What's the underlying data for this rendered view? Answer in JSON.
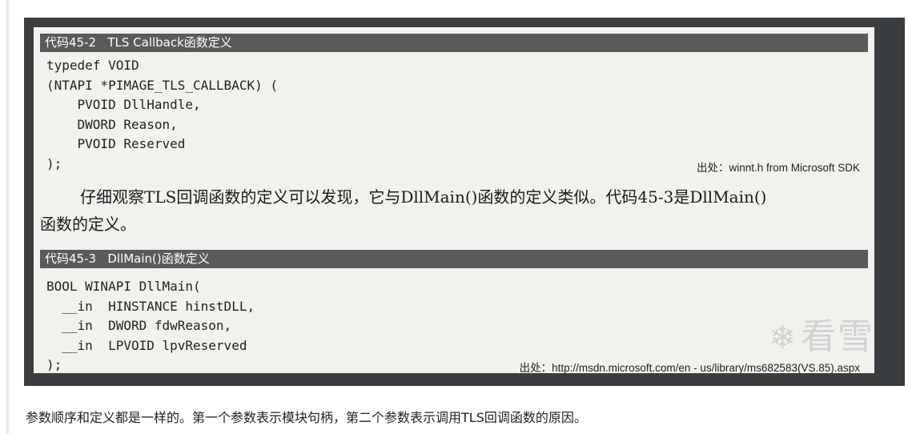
{
  "scan": {
    "listing1": {
      "caption": "代码45-2   TLS Callback函数定义",
      "code": "typedef VOID\n(NTAPI *PIMAGE_TLS_CALLBACK) (\n    PVOID DllHandle,\n    DWORD Reason,\n    PVOID Reserved\n);",
      "source": "出处：winnt.h from Microsoft SDK"
    },
    "paragraph_line1": "仔细观察TLS回调函数的定义可以发现，它与DllMain()函数的定义类似。代码45-3是DllMain()",
    "paragraph_line2": "函数的定义。",
    "listing2": {
      "caption": "代码45-3   DllMain()函数定义",
      "code": "BOOL WINAPI DllMain(\n  __in  HINSTANCE hinstDLL,\n  __in  DWORD fdwReason,\n  __in  LPVOID lpvReserved\n);",
      "source": "出处：http://msdn.microsoft.com/en - us/library/ms682583(VS.85).aspx"
    },
    "watermark": "看雪"
  },
  "caption_below": "参数顺序和定义都是一样的。第一个参数表示模块句柄，第二个参数表示调用TLS回调函数的原因。"
}
